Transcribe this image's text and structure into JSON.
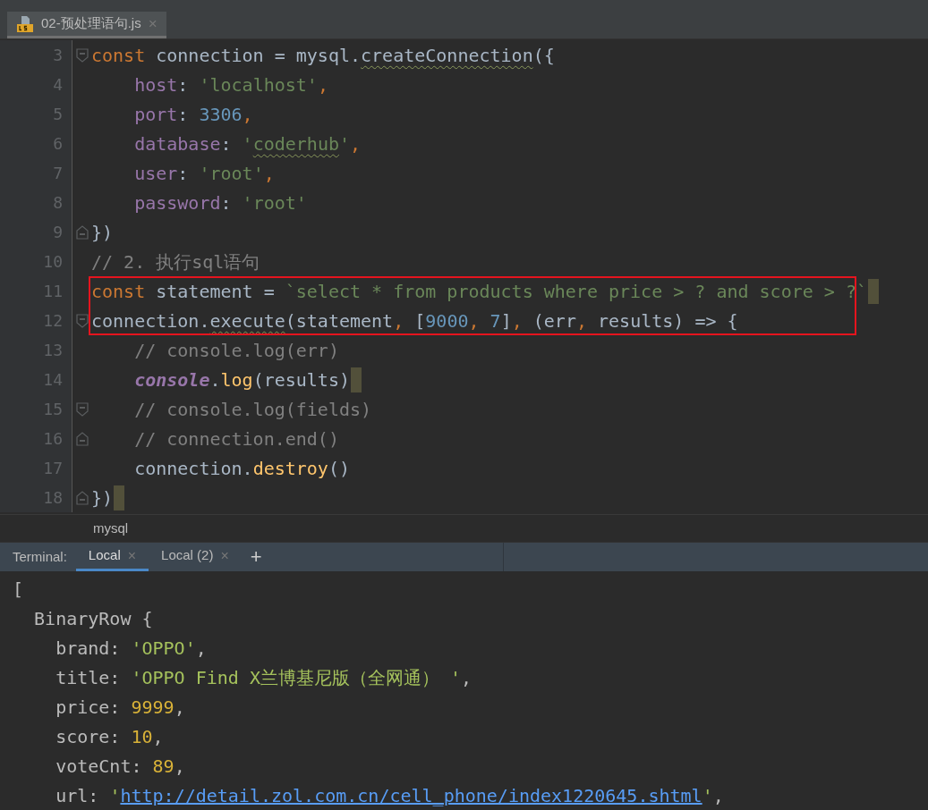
{
  "editor_tabs": [
    {
      "label": "02-预处理语句.js",
      "selected": true,
      "close": "×"
    }
  ],
  "editor": {
    "lines": [
      {
        "number": "3",
        "foldable": true,
        "highlighted": false,
        "caret_mark": false,
        "tokens": [
          {
            "text": "const ",
            "kind": "keyword"
          },
          {
            "text": "connection = mysql.",
            "kind": "plain"
          },
          {
            "text": "createConnection",
            "kind": "plain",
            "squiggle": true
          },
          {
            "text": "({",
            "kind": "plain"
          }
        ]
      },
      {
        "number": "4",
        "highlighted": false,
        "caret_mark": false,
        "tokens": [
          {
            "text": "    host",
            "kind": "property"
          },
          {
            "text": ": ",
            "kind": "plain"
          },
          {
            "text": "'localhost'",
            "kind": "string"
          },
          {
            "text": ",",
            "kind": "keyword"
          }
        ]
      },
      {
        "number": "5",
        "highlighted": false,
        "caret_mark": false,
        "tokens": [
          {
            "text": "    port",
            "kind": "property"
          },
          {
            "text": ": ",
            "kind": "plain"
          },
          {
            "text": "3306",
            "kind": "number"
          },
          {
            "text": ",",
            "kind": "keyword"
          }
        ]
      },
      {
        "number": "6",
        "highlighted": false,
        "caret_mark": false,
        "tokens": [
          {
            "text": "    database",
            "kind": "property"
          },
          {
            "text": ": ",
            "kind": "plain"
          },
          {
            "text": "'",
            "kind": "string"
          },
          {
            "text": "coderhub",
            "kind": "string",
            "squiggle": true
          },
          {
            "text": "'",
            "kind": "string"
          },
          {
            "text": ",",
            "kind": "keyword"
          }
        ]
      },
      {
        "number": "7",
        "highlighted": false,
        "caret_mark": false,
        "tokens": [
          {
            "text": "    user",
            "kind": "property"
          },
          {
            "text": ": ",
            "kind": "plain"
          },
          {
            "text": "'root'",
            "kind": "string"
          },
          {
            "text": ",",
            "kind": "keyword"
          }
        ]
      },
      {
        "number": "8",
        "highlighted": false,
        "caret_mark": false,
        "tokens": [
          {
            "text": "    password",
            "kind": "property"
          },
          {
            "text": ": ",
            "kind": "plain"
          },
          {
            "text": "'root'",
            "kind": "string"
          }
        ]
      },
      {
        "number": "9",
        "fold_end": true,
        "highlighted": false,
        "caret_mark": false,
        "tokens": [
          {
            "text": "})",
            "kind": "plain"
          }
        ]
      },
      {
        "number": "10",
        "highlighted": false,
        "caret_mark": false,
        "tokens": [
          {
            "text": "// 2. 执行sql语句",
            "kind": "comment"
          }
        ]
      },
      {
        "number": "11",
        "highlighted": true,
        "caret_mark": true,
        "tokens": [
          {
            "text": "const ",
            "kind": "keyword"
          },
          {
            "text": "statement = ",
            "kind": "plain"
          },
          {
            "text": "`select * from products where price > ? and score > ?`",
            "kind": "string"
          }
        ]
      },
      {
        "number": "12",
        "foldable": true,
        "highlighted": true,
        "caret_mark": false,
        "tokens": [
          {
            "text": "connection.",
            "kind": "plain"
          },
          {
            "text": "execute",
            "kind": "plain",
            "squiggle": true
          },
          {
            "text": "(statement",
            "kind": "plain"
          },
          {
            "text": ", ",
            "kind": "keyword"
          },
          {
            "text": "[",
            "kind": "plain"
          },
          {
            "text": "9000",
            "kind": "number"
          },
          {
            "text": ", ",
            "kind": "keyword"
          },
          {
            "text": "7",
            "kind": "number"
          },
          {
            "text": "]",
            "kind": "plain"
          },
          {
            "text": ", ",
            "kind": "keyword"
          },
          {
            "text": "(err",
            "kind": "plain"
          },
          {
            "text": ", ",
            "kind": "keyword"
          },
          {
            "text": "results) => {",
            "kind": "plain"
          }
        ]
      },
      {
        "number": "13",
        "highlighted": false,
        "caret_mark": false,
        "tokens": [
          {
            "text": "    // console.log(err)",
            "kind": "comment"
          }
        ]
      },
      {
        "number": "14",
        "highlighted": false,
        "caret_mark": true,
        "tokens": [
          {
            "text": "    console",
            "kind": "global"
          },
          {
            "text": ".",
            "kind": "plain"
          },
          {
            "text": "log",
            "kind": "method"
          },
          {
            "text": "(results)",
            "kind": "plain"
          }
        ]
      },
      {
        "number": "15",
        "foldable": true,
        "highlighted": false,
        "caret_mark": false,
        "tokens": [
          {
            "text": "    // console.log(fields)",
            "kind": "comment"
          }
        ]
      },
      {
        "number": "16",
        "fold_end": true,
        "highlighted": false,
        "caret_mark": false,
        "tokens": [
          {
            "text": "    // connection.end()",
            "kind": "comment"
          }
        ]
      },
      {
        "number": "17",
        "highlighted": false,
        "caret_mark": false,
        "tokens": [
          {
            "text": "    connection.",
            "kind": "plain"
          },
          {
            "text": "destroy",
            "kind": "method"
          },
          {
            "text": "()",
            "kind": "plain"
          }
        ]
      },
      {
        "number": "18",
        "fold_end": true,
        "highlighted": false,
        "caret_mark": true,
        "tokens": [
          {
            "text": "})",
            "kind": "plain"
          }
        ]
      }
    ]
  },
  "breadcrumb": "mysql",
  "terminal": {
    "label": "Terminal:",
    "tabs": [
      {
        "label": "Local",
        "selected": true,
        "close": "×"
      },
      {
        "label": "Local (2)",
        "selected": false,
        "close": "×"
      }
    ],
    "add": "+",
    "lines": [
      {
        "tokens": [
          {
            "text": "[",
            "kind": "plain"
          }
        ]
      },
      {
        "tokens": [
          {
            "text": "  BinaryRow {",
            "kind": "plain"
          }
        ]
      },
      {
        "tokens": [
          {
            "text": "    brand: ",
            "kind": "plain"
          },
          {
            "text": "'OPPO'",
            "kind": "string"
          },
          {
            "text": ",",
            "kind": "plain"
          }
        ]
      },
      {
        "tokens": [
          {
            "text": "    title: ",
            "kind": "plain"
          },
          {
            "text": "'OPPO Find X兰博基尼版（全网通） '",
            "kind": "string"
          },
          {
            "text": ",",
            "kind": "plain"
          }
        ]
      },
      {
        "tokens": [
          {
            "text": "    price: ",
            "kind": "plain"
          },
          {
            "text": "9999",
            "kind": "number"
          },
          {
            "text": ",",
            "kind": "plain"
          }
        ]
      },
      {
        "tokens": [
          {
            "text": "    score: ",
            "kind": "plain"
          },
          {
            "text": "10",
            "kind": "number"
          },
          {
            "text": ",",
            "kind": "plain"
          }
        ]
      },
      {
        "tokens": [
          {
            "text": "    voteCnt: ",
            "kind": "plain"
          },
          {
            "text": "89",
            "kind": "number"
          },
          {
            "text": ",",
            "kind": "plain"
          }
        ]
      },
      {
        "tokens": [
          {
            "text": "    url: ",
            "kind": "plain"
          },
          {
            "text": "'",
            "kind": "string"
          },
          {
            "text": "http://detail.zol.com.cn/cell_phone/index1220645.shtml",
            "kind": "link"
          },
          {
            "text": "'",
            "kind": "string"
          },
          {
            "text": ",",
            "kind": "plain"
          }
        ]
      }
    ]
  }
}
